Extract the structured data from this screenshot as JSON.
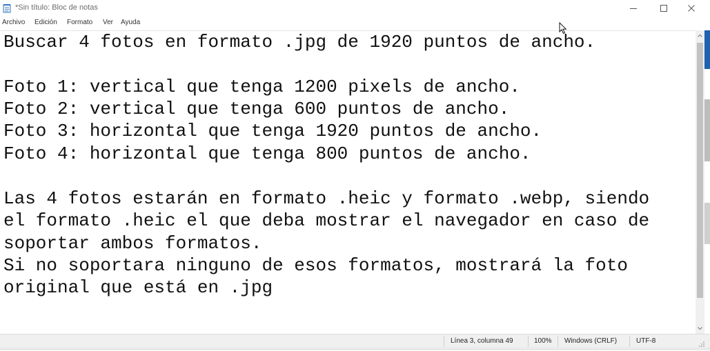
{
  "window": {
    "title": "*Sin título: Bloc de notas"
  },
  "menu": [
    "Archivo",
    "Edición",
    "Formato",
    "Ver",
    "Ayuda"
  ],
  "editor": {
    "lines": [
      "Buscar 4 fotos en formato .jpg de 1920 puntos de ancho.",
      "",
      "Foto 1: vertical que tenga 1200 pixels de ancho.",
      "Foto 2: vertical que tenga 600 puntos de ancho.",
      "Foto 3: horizontal que tenga 1920 puntos de ancho.",
      "Foto 4: horizontal que tenga 800 puntos de ancho.",
      "",
      "Las 4 fotos estarán en formato .heic y formato .webp, siendo",
      "el formato .heic el que deba mostrar el navegador en caso de",
      "soportar ambos formatos.",
      "Si no soportara ninguno de esos formatos, mostrará la foto",
      "original que está en .jpg"
    ]
  },
  "status": {
    "position": "Línea 3, columna 49",
    "zoom": "100%",
    "line_ending": "Windows (CRLF)",
    "encoding": "UTF-8"
  },
  "icons": {
    "app": "notepad-icon",
    "minimize": "minimize-icon",
    "maximize": "maximize-icon",
    "close": "close-icon"
  }
}
